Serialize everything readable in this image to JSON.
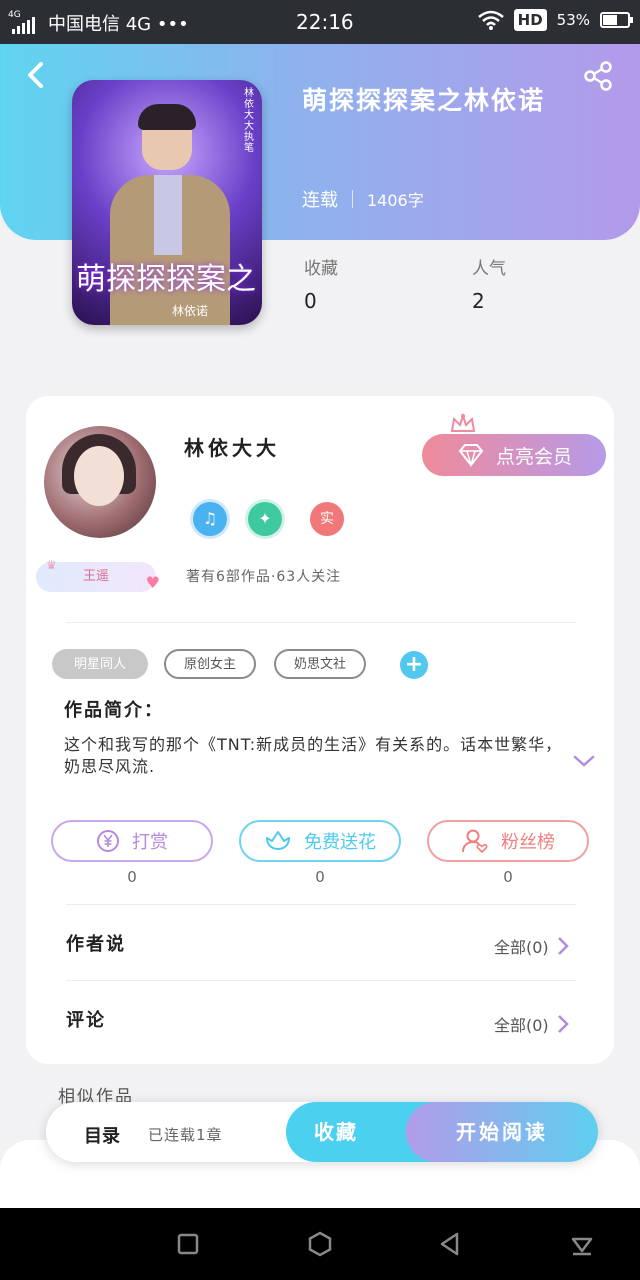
{
  "status_bar": {
    "network_label": "4G",
    "carrier": "中国电信 4G •••",
    "time": "22:16",
    "hd": "HD",
    "battery": "53%"
  },
  "book": {
    "title": "萌探探探案之林依诺",
    "status": "连载",
    "word_count": "1406字",
    "cover": {
      "title": "萌探探探案之",
      "author": "林依诺",
      "vertical_text": "林依大大 执笔"
    }
  },
  "stats": [
    {
      "label": "收藏",
      "value": "0"
    },
    {
      "label": "人气",
      "value": "2"
    }
  ],
  "author": {
    "name": "林依大大",
    "badge": "王遥",
    "vip_button": "点亮会员",
    "medals": [
      {
        "icon": "music-note-icon",
        "glyph": "♫",
        "color": "#4ab2f0"
      },
      {
        "icon": "handshake-icon",
        "glyph": "✦",
        "color": "#3fc9a0"
      },
      {
        "icon": "real-name-icon",
        "glyph": "实",
        "color": "#f07878"
      }
    ],
    "summary": "著有6部作品·63人关注"
  },
  "tags": [
    "明星同人",
    "原创女主",
    "奶思文社"
  ],
  "intro": {
    "title": "作品简介：",
    "text": "这个和我写的那个《TNT:新成员的生活》有关系的。话本世繁华，奶思尽风流."
  },
  "actions": [
    {
      "label": "打赏",
      "count": "0",
      "color": "#b48ae0",
      "icon": "yuan-icon"
    },
    {
      "label": "免费送花",
      "count": "0",
      "color": "#4ccbee",
      "icon": "flower-icon"
    },
    {
      "label": "粉丝榜",
      "count": "0",
      "color": "#ef7f7f",
      "icon": "fan-icon"
    }
  ],
  "sections": [
    {
      "title": "作者说",
      "link": "全部(0)"
    },
    {
      "title": "评论",
      "link": "全部(0)"
    }
  ],
  "similar_title": "相似作品",
  "bottom_bar": {
    "toc": "目录",
    "toc_status": "已连载1章",
    "favorite": "收藏",
    "read": "开始阅读"
  }
}
